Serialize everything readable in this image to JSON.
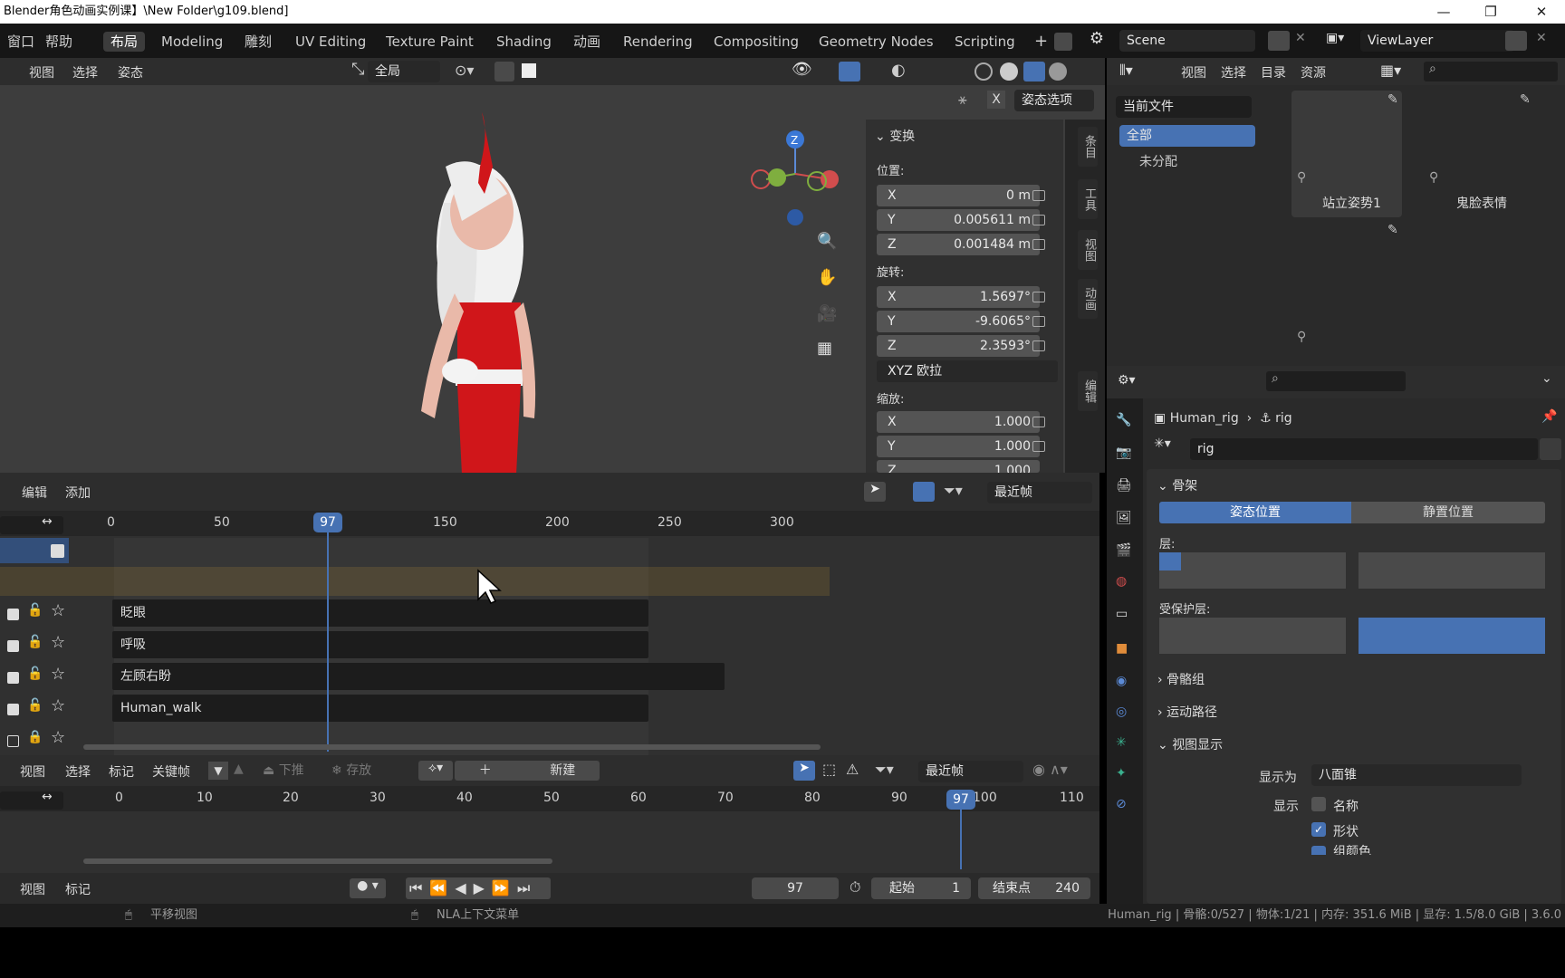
{
  "window": {
    "title": "Blender角色动画实例课】\\New Folder\\g109.blend]",
    "min": "—",
    "max": "❐",
    "close": "✕"
  },
  "topbar": {
    "menus": [
      "窗口",
      "帮助"
    ],
    "workspaces": [
      "布局",
      "Modeling",
      "雕刻",
      "UV Editing",
      "Texture Paint",
      "Shading",
      "动画",
      "Rendering",
      "Compositing",
      "Geometry Nodes",
      "Scripting"
    ],
    "add": "+",
    "scene": "Scene",
    "viewlayer": "ViewLayer"
  },
  "viewport": {
    "menus": [
      "视图",
      "选择",
      "姿态"
    ],
    "orientation": "全局",
    "pose_options": "姿态选项",
    "x_label": "X"
  },
  "npanel": {
    "title": "变换",
    "location_label": "位置:",
    "location": [
      {
        "axis": "X",
        "value": "0 m"
      },
      {
        "axis": "Y",
        "value": "0.005611 m"
      },
      {
        "axis": "Z",
        "value": "0.001484 m"
      }
    ],
    "rotation_label": "旋转:",
    "rotation": [
      {
        "axis": "X",
        "value": "1.5697°"
      },
      {
        "axis": "Y",
        "value": "-9.6065°"
      },
      {
        "axis": "Z",
        "value": "2.3593°"
      }
    ],
    "rotation_mode": "XYZ 欧拉",
    "scale_label": "缩放:",
    "scale": [
      {
        "axis": "X",
        "value": "1.000"
      },
      {
        "axis": "Y",
        "value": "1.000"
      },
      {
        "axis": "Z",
        "value": "1.000"
      }
    ],
    "tabs": [
      "条目",
      "工具",
      "视图",
      "动画",
      "编辑"
    ]
  },
  "nla": {
    "menus": [
      "编辑",
      "添加"
    ],
    "snap": "最近帧",
    "ruler": [
      "0",
      "50",
      "150",
      "200",
      "250",
      "300"
    ],
    "current_frame": "97",
    "tracks": [
      {
        "name": "眨眼"
      },
      {
        "name": "呼吸"
      },
      {
        "name": "左顾右盼"
      },
      {
        "name": "Human_walk"
      }
    ]
  },
  "dopesheet": {
    "menus": [
      "视图",
      "选择",
      "标记",
      "关键帧"
    ],
    "push_down": "下推",
    "stash": "存放",
    "new": "新建",
    "snap": "最近帧",
    "ruler": [
      "0",
      "10",
      "20",
      "30",
      "40",
      "50",
      "60",
      "70",
      "80",
      "90",
      "100",
      "110"
    ],
    "current_frame": "97"
  },
  "timeline": {
    "menus": [
      "视图",
      "标记"
    ],
    "frame": "97",
    "start_label": "起始",
    "start": "1",
    "end_label": "结束点",
    "end": "240"
  },
  "status": {
    "left": "平移视图",
    "middle": "NLA上下文菜单",
    "right": "Human_rig | 骨骼:0/527 | 物体:1/21 | 内存: 351.6 MiB | 显存: 1.5/8.0 GiB | 3.6.0"
  },
  "outliner": {
    "menus": [
      "视图",
      "选择",
      "目录",
      "资源"
    ],
    "source": "当前文件",
    "items": [
      "全部",
      "未分配"
    ],
    "poses": [
      "站立姿势1",
      "鬼脸表情"
    ]
  },
  "properties": {
    "path_obj": "Human_rig",
    "path_data": "rig",
    "name": "rig",
    "armature": "骨架",
    "pose_pos": "姿态位置",
    "rest_pos": "静置位置",
    "layers": "层:",
    "protected": "受保护层:",
    "bone_groups": "骨骼组",
    "motion_paths": "运动路径",
    "viewport_display": "视图显示",
    "display_as_label": "显示为",
    "display_as": "八面锥",
    "show_label": "显示",
    "show_names": "名称",
    "show_shapes": "形状",
    "show_group_colors": "组颜色"
  },
  "colors": {
    "accent": "#4772b3",
    "red": "#d0161a"
  }
}
